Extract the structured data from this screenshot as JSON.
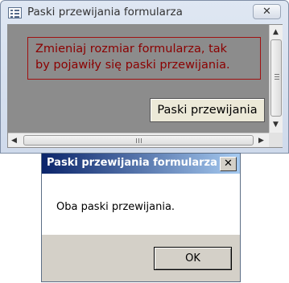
{
  "main_window": {
    "title": "Paski przewijania formularza",
    "close_glyph": "✕",
    "form": {
      "message_line1": "Zmieniaj rozmiar formularza, tak",
      "message_line2": "by pojawiły się paski przewijania.",
      "button_label": "Paski przewijania"
    }
  },
  "dialog": {
    "title": "Paski przewijania formularza",
    "close_glyph": "✕",
    "message": "Oba paski przewijania.",
    "ok_label": "OK"
  },
  "colors": {
    "form_background": "#8c8c8c",
    "message_text": "#8b0000",
    "dialog_title_gradient_start": "#0a246a",
    "dialog_title_gradient_end": "#a6caf0"
  },
  "icons": [
    "form-window-icon",
    "close-icon",
    "arrow-up-icon",
    "arrow-down-icon",
    "arrow-left-icon",
    "arrow-right-icon"
  ]
}
